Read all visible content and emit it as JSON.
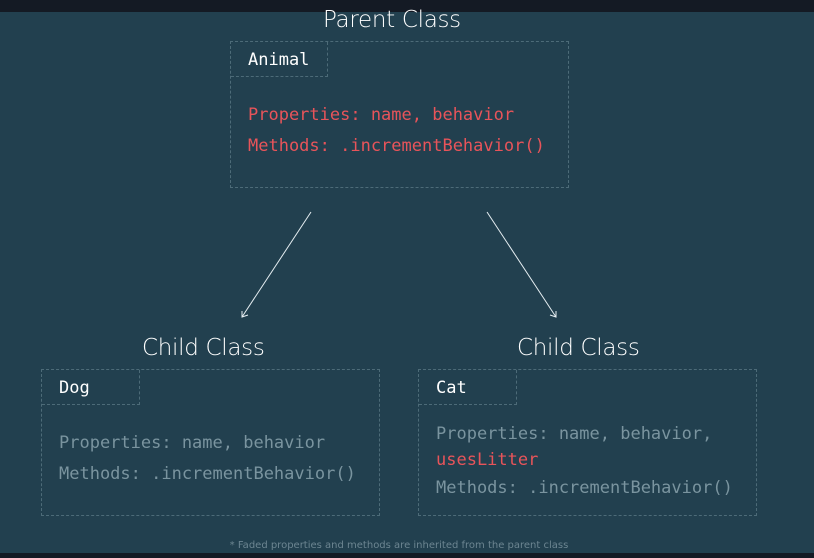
{
  "parent": {
    "heading": "Parent Class",
    "class_name": "Animal",
    "properties": "Properties: name, behavior",
    "methods": "Methods: .incrementBehavior()"
  },
  "children": [
    {
      "heading": "Child Class",
      "class_name": "Dog",
      "properties": "Properties: name, behavior",
      "methods": "Methods: .incrementBehavior()"
    },
    {
      "heading": "Child Class",
      "class_name": "Cat",
      "properties": "Properties: name, behavior,",
      "extra_property": "usesLitter",
      "methods": "Methods: .incrementBehavior()"
    }
  ],
  "footnote": "* Faded properties and methods are inherited from the parent class",
  "colors": {
    "background": "#22404f",
    "own_member": "#e8545a",
    "inherited_member": "#7a949f",
    "border": "#4d6b78"
  }
}
